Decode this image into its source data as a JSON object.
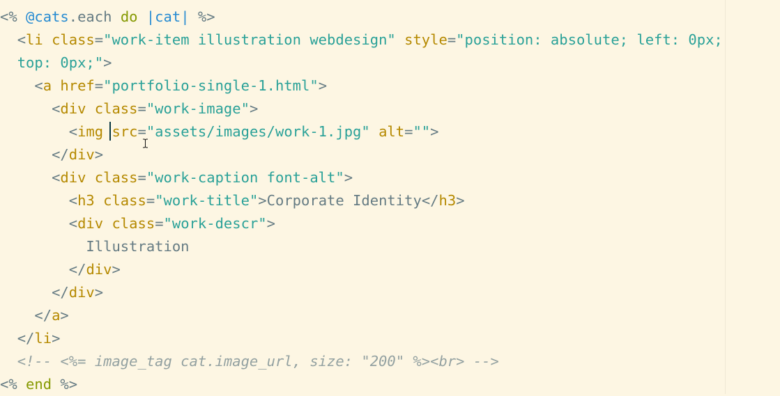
{
  "editor": {
    "theme": {
      "background": "#fdf6e3",
      "text": "#657b83",
      "keyword": "#859900",
      "instance_variable": "#268bd2",
      "tag_and_attribute": "#b58900",
      "string": "#2aa198",
      "comment": "#93a1a1"
    },
    "lines": [
      {
        "indent": "",
        "tokens": [
          {
            "t": "erb",
            "v": "<% "
          },
          {
            "t": "ivar",
            "v": "@cats"
          },
          {
            "t": "text",
            "v": ".each "
          },
          {
            "t": "kw",
            "v": "do"
          },
          {
            "t": "text",
            "v": " "
          },
          {
            "t": "ivar",
            "v": "|cat|"
          },
          {
            "t": "text",
            "v": " "
          },
          {
            "t": "erb",
            "v": "%>"
          }
        ]
      },
      {
        "indent": "  ",
        "tokens": [
          {
            "t": "punct",
            "v": "<"
          },
          {
            "t": "tag",
            "v": "li"
          },
          {
            "t": "text",
            "v": " "
          },
          {
            "t": "attr",
            "v": "class"
          },
          {
            "t": "punct",
            "v": "="
          },
          {
            "t": "val",
            "v": "\"work-item illustration webdesign\""
          },
          {
            "t": "text",
            "v": " "
          },
          {
            "t": "attr",
            "v": "style"
          },
          {
            "t": "punct",
            "v": "="
          },
          {
            "t": "val",
            "v": "\"position: absolute; left: 0px;"
          }
        ]
      },
      {
        "indent": "  ",
        "tokens": [
          {
            "t": "val",
            "v": "top: 0px;\""
          },
          {
            "t": "punct",
            "v": ">"
          }
        ]
      },
      {
        "indent": "    ",
        "tokens": [
          {
            "t": "punct",
            "v": "<"
          },
          {
            "t": "tag",
            "v": "a"
          },
          {
            "t": "text",
            "v": " "
          },
          {
            "t": "attr",
            "v": "href"
          },
          {
            "t": "punct",
            "v": "="
          },
          {
            "t": "val",
            "v": "\"portfolio-single-1.html\""
          },
          {
            "t": "punct",
            "v": ">"
          }
        ]
      },
      {
        "indent": "      ",
        "tokens": [
          {
            "t": "punct",
            "v": "<"
          },
          {
            "t": "tag",
            "v": "div"
          },
          {
            "t": "text",
            "v": " "
          },
          {
            "t": "attr",
            "v": "class"
          },
          {
            "t": "punct",
            "v": "="
          },
          {
            "t": "val",
            "v": "\"work-image\""
          },
          {
            "t": "punct",
            "v": ">"
          }
        ]
      },
      {
        "indent": "        ",
        "tokens": [
          {
            "t": "punct",
            "v": "<"
          },
          {
            "t": "tag",
            "v": "img"
          },
          {
            "t": "text",
            "v": " "
          },
          {
            "t": "attr",
            "v": "src"
          },
          {
            "t": "punct",
            "v": "="
          },
          {
            "t": "val",
            "v": "\"assets/images/work-1.jpg\""
          },
          {
            "t": "text",
            "v": " "
          },
          {
            "t": "attr",
            "v": "alt"
          },
          {
            "t": "punct",
            "v": "="
          },
          {
            "t": "val",
            "v": "\"\""
          },
          {
            "t": "punct",
            "v": ">"
          }
        ]
      },
      {
        "indent": "      ",
        "tokens": [
          {
            "t": "punct",
            "v": "</"
          },
          {
            "t": "tag",
            "v": "div"
          },
          {
            "t": "punct",
            "v": ">"
          }
        ]
      },
      {
        "indent": "      ",
        "tokens": [
          {
            "t": "punct",
            "v": "<"
          },
          {
            "t": "tag",
            "v": "div"
          },
          {
            "t": "text",
            "v": " "
          },
          {
            "t": "attr",
            "v": "class"
          },
          {
            "t": "punct",
            "v": "="
          },
          {
            "t": "val",
            "v": "\"work-caption font-alt\""
          },
          {
            "t": "punct",
            "v": ">"
          }
        ]
      },
      {
        "indent": "        ",
        "tokens": [
          {
            "t": "punct",
            "v": "<"
          },
          {
            "t": "tag",
            "v": "h3"
          },
          {
            "t": "text",
            "v": " "
          },
          {
            "t": "attr",
            "v": "class"
          },
          {
            "t": "punct",
            "v": "="
          },
          {
            "t": "val",
            "v": "\"work-title\""
          },
          {
            "t": "punct",
            "v": ">"
          },
          {
            "t": "text",
            "v": "Corporate Identity"
          },
          {
            "t": "punct",
            "v": "</"
          },
          {
            "t": "tag",
            "v": "h3"
          },
          {
            "t": "punct",
            "v": ">"
          }
        ]
      },
      {
        "indent": "        ",
        "tokens": [
          {
            "t": "punct",
            "v": "<"
          },
          {
            "t": "tag",
            "v": "div"
          },
          {
            "t": "text",
            "v": " "
          },
          {
            "t": "attr",
            "v": "class"
          },
          {
            "t": "punct",
            "v": "="
          },
          {
            "t": "val",
            "v": "\"work-descr\""
          },
          {
            "t": "punct",
            "v": ">"
          }
        ]
      },
      {
        "indent": "          ",
        "tokens": [
          {
            "t": "text",
            "v": "Illustration"
          }
        ]
      },
      {
        "indent": "        ",
        "tokens": [
          {
            "t": "punct",
            "v": "</"
          },
          {
            "t": "tag",
            "v": "div"
          },
          {
            "t": "punct",
            "v": ">"
          }
        ]
      },
      {
        "indent": "      ",
        "tokens": [
          {
            "t": "punct",
            "v": "</"
          },
          {
            "t": "tag",
            "v": "div"
          },
          {
            "t": "punct",
            "v": ">"
          }
        ]
      },
      {
        "indent": "    ",
        "tokens": [
          {
            "t": "punct",
            "v": "</"
          },
          {
            "t": "tag",
            "v": "a"
          },
          {
            "t": "punct",
            "v": ">"
          }
        ]
      },
      {
        "indent": "  ",
        "tokens": [
          {
            "t": "punct",
            "v": "</"
          },
          {
            "t": "tag",
            "v": "li"
          },
          {
            "t": "punct",
            "v": ">"
          }
        ]
      },
      {
        "indent": "  ",
        "tokens": [
          {
            "t": "comment",
            "v": "<!-- <%= image_tag cat.image_url, size: \"200\" %><br> -->"
          }
        ]
      },
      {
        "indent": "",
        "tokens": [
          {
            "t": "erb",
            "v": "<% "
          },
          {
            "t": "kw",
            "v": "end"
          },
          {
            "t": "text",
            "v": " "
          },
          {
            "t": "erb",
            "v": "%>"
          }
        ]
      }
    ]
  }
}
